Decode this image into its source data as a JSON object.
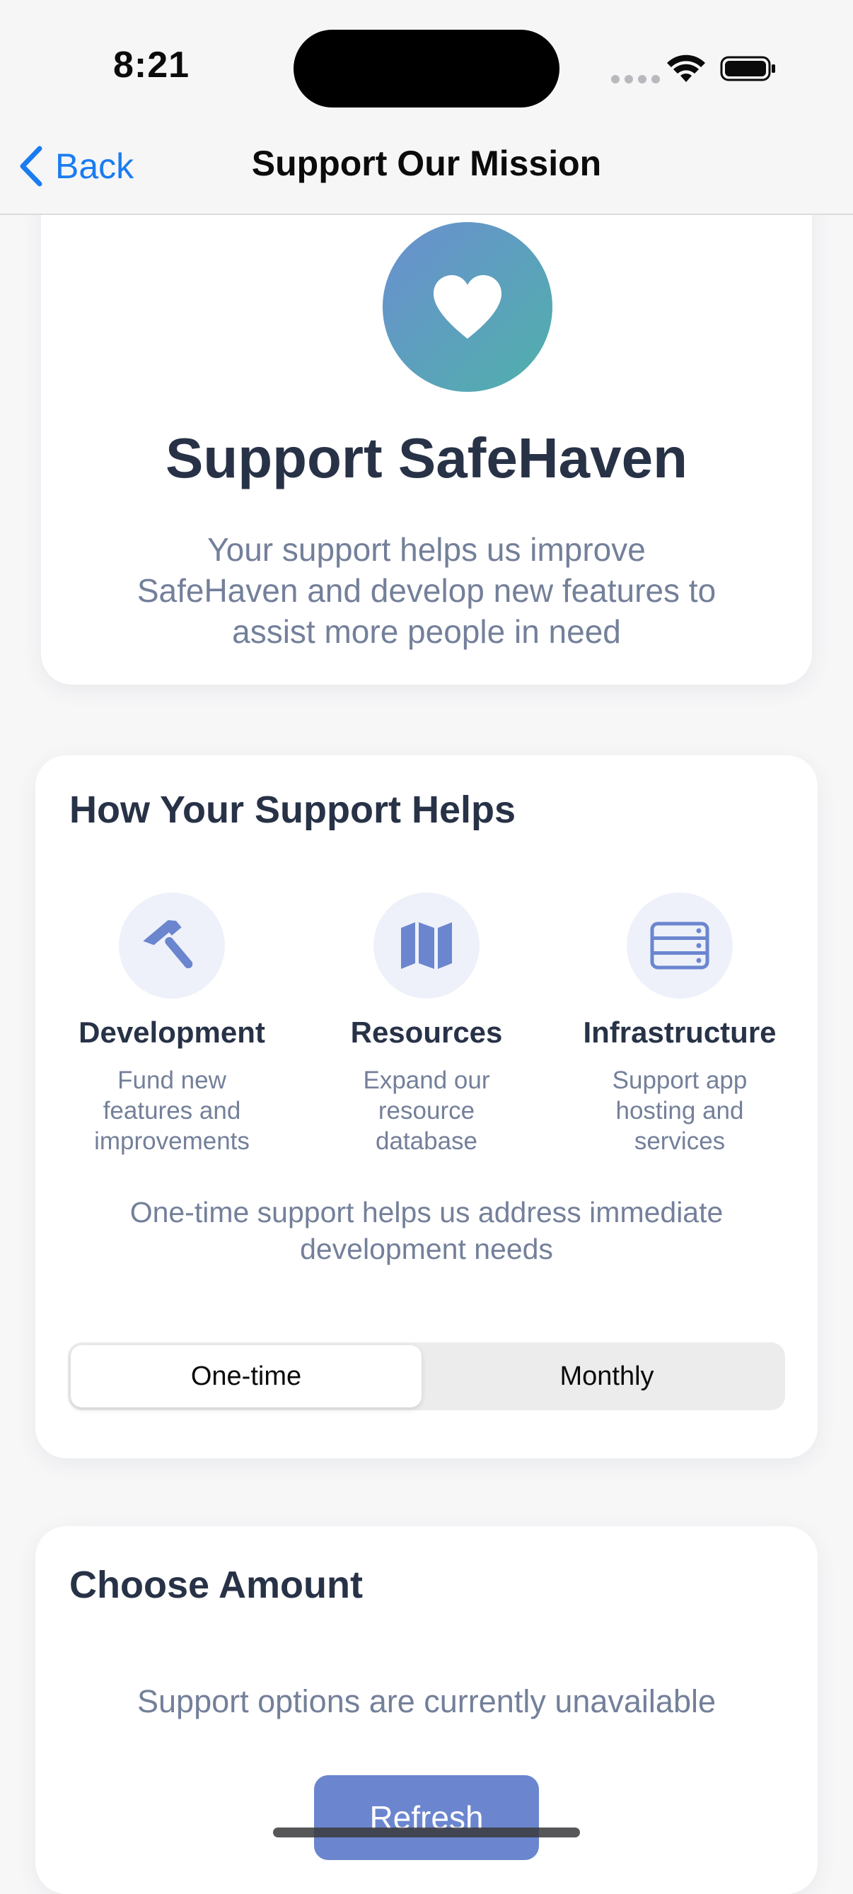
{
  "status_bar": {
    "time": "8:21"
  },
  "nav": {
    "back_label": "Back",
    "title": "Support Our Mission"
  },
  "hero": {
    "icon": "heart-icon",
    "title": "Support SafeHaven",
    "subtitle": "Your support helps us improve SafeHaven and develop new features to assist more people in need"
  },
  "helps": {
    "title": "How Your Support Helps",
    "features": [
      {
        "icon": "hammer-icon",
        "title": "Development",
        "description": "Fund new features and improvements"
      },
      {
        "icon": "map-icon",
        "title": "Resources",
        "description": "Expand our resource database"
      },
      {
        "icon": "server-icon",
        "title": "Infrastructure",
        "description": "Support app hosting and services"
      }
    ],
    "note": "One-time support helps us address immediate development needs",
    "segments": [
      "One-time",
      "Monthly"
    ],
    "selected_segment": "One-time"
  },
  "amount": {
    "title": "Choose Amount",
    "message": "Support options are currently unavailable",
    "refresh_label": "Refresh"
  },
  "colors": {
    "accent_blue": "#1a7cf0",
    "icon_blue": "#6b86cf",
    "gradient_start": "#6b8fd1",
    "gradient_end": "#4fb0aa",
    "title_text": "#283247",
    "muted_text": "#74809a"
  }
}
